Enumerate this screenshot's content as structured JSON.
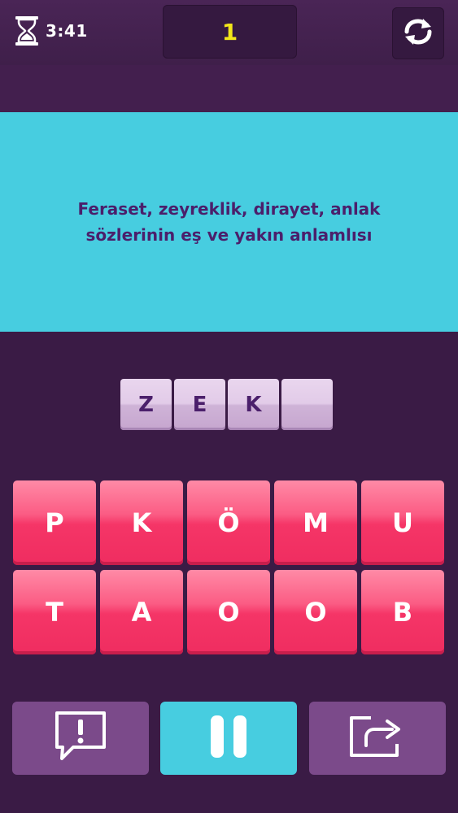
{
  "header": {
    "timer": "3:41",
    "score": "1",
    "timer_icon": "hourglass-icon",
    "refresh_icon": "refresh-icon"
  },
  "question": {
    "line1": "Feraset, zeyreklik, dirayet, anlak",
    "line2": "sözlerinin eş ve yakın anlamlısı"
  },
  "answer": {
    "slots": [
      "Z",
      "E",
      "K",
      ""
    ]
  },
  "letters": {
    "row1": [
      "P",
      "K",
      "Ö",
      "M",
      "U"
    ],
    "row2": [
      "T",
      "A",
      "O",
      "O",
      "B"
    ]
  },
  "footer": {
    "hint_icon": "exclamation-speech-icon",
    "pause_icon": "pause-icon",
    "skip_icon": "share-arrow-icon"
  },
  "colors": {
    "background": "#3a1b45",
    "question_panel": "#47cde0",
    "question_text": "#4b1f6b",
    "score_text": "#f2e51a",
    "letter_tile": "#f53567",
    "answer_tile": "#e2cbe8",
    "side_button": "#7b4a8a"
  }
}
